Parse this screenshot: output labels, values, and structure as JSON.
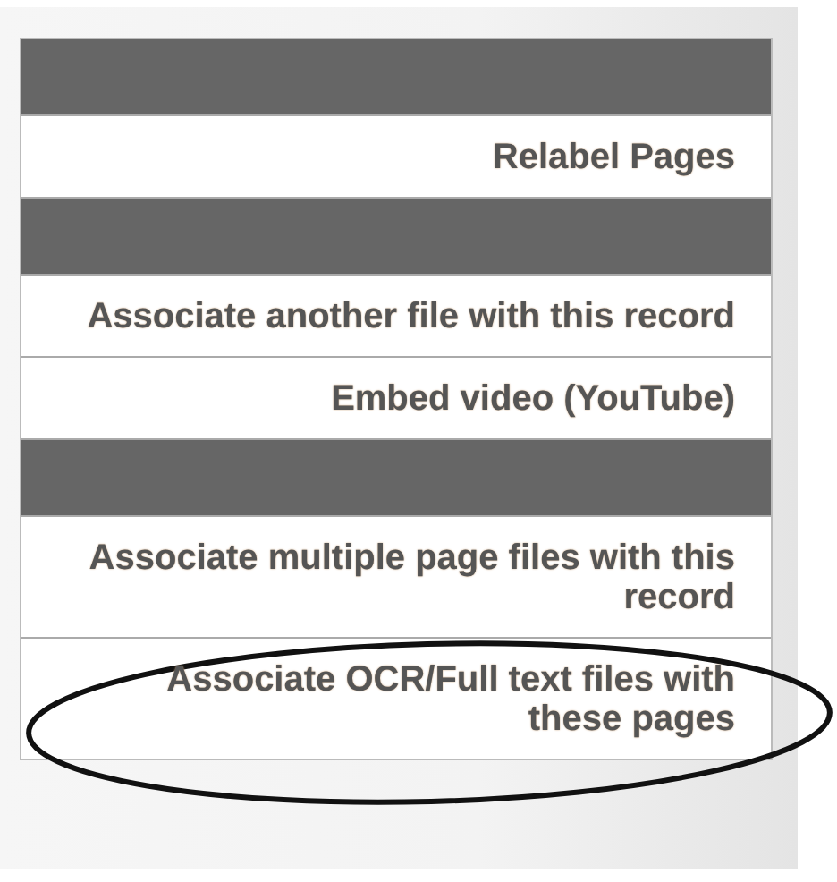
{
  "menu": {
    "items": [
      {
        "kind": "header"
      },
      {
        "kind": "link",
        "label": "Relabel Pages",
        "circled": false
      },
      {
        "kind": "header"
      },
      {
        "kind": "link",
        "label": "Associate another file with this record",
        "circled": false
      },
      {
        "kind": "link",
        "label": "Embed video (YouTube)",
        "circled": false
      },
      {
        "kind": "header"
      },
      {
        "kind": "link",
        "label": "Associate multiple page files with this record",
        "circled": false
      },
      {
        "kind": "link",
        "label": "Associate OCR/Full text files with these pages",
        "circled": true
      }
    ]
  }
}
